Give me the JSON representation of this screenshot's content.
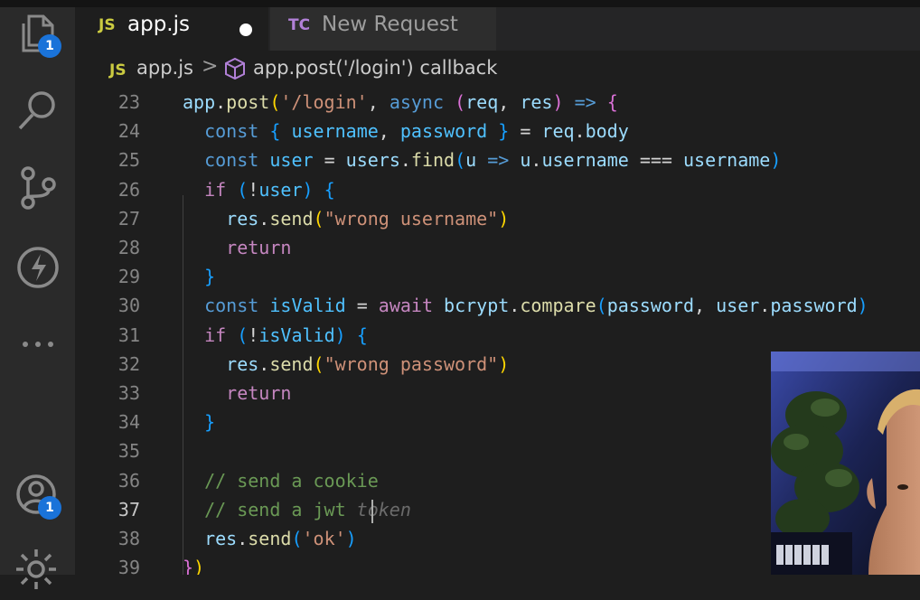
{
  "activity_bar": {
    "explorer_badge": "1",
    "accounts_badge": "1"
  },
  "tabs": [
    {
      "icon_text": "JS",
      "label": "app.js",
      "icon_color": "#cbcb41",
      "label_color": "#ffffff"
    },
    {
      "icon_text": "TC",
      "label": "New Request",
      "icon_color": "#b180d7",
      "label_color": "#9d9d9d"
    }
  ],
  "breadcrumb": {
    "file_icon": "JS",
    "file": "app.js",
    "separator": ">",
    "symbol": "app.post('/login') callback"
  },
  "editor": {
    "line_numbers": [
      "23",
      "24",
      "25",
      "26",
      "27",
      "28",
      "29",
      "30",
      "31",
      "32",
      "33",
      "34",
      "35",
      "36",
      "37",
      "38",
      "39"
    ],
    "current_line": "37",
    "lines": [
      [
        {
          "t": "app",
          "c": "var"
        },
        {
          "t": ".",
          "c": ""
        },
        {
          "t": "post",
          "c": "fn"
        },
        {
          "t": "(",
          "c": "b1"
        },
        {
          "t": "'/login'",
          "c": "str"
        },
        {
          "t": ", ",
          "c": ""
        },
        {
          "t": "async",
          "c": "kw"
        },
        {
          "t": " ",
          "c": ""
        },
        {
          "t": "(",
          "c": "b2"
        },
        {
          "t": "req",
          "c": "var"
        },
        {
          "t": ", ",
          "c": ""
        },
        {
          "t": "res",
          "c": "var"
        },
        {
          "t": ")",
          "c": "b2"
        },
        {
          "t": " ",
          "c": ""
        },
        {
          "t": "=>",
          "c": "kw"
        },
        {
          "t": " ",
          "c": ""
        },
        {
          "t": "{",
          "c": "b2"
        }
      ],
      [
        {
          "t": "  ",
          "c": ""
        },
        {
          "t": "const",
          "c": "kw"
        },
        {
          "t": " ",
          "c": ""
        },
        {
          "t": "{",
          "c": "b3"
        },
        {
          "t": " ",
          "c": ""
        },
        {
          "t": "username",
          "c": "cst"
        },
        {
          "t": ", ",
          "c": ""
        },
        {
          "t": "password",
          "c": "cst"
        },
        {
          "t": " ",
          "c": ""
        },
        {
          "t": "}",
          "c": "b3"
        },
        {
          "t": " = ",
          "c": ""
        },
        {
          "t": "req",
          "c": "var"
        },
        {
          "t": ".",
          "c": ""
        },
        {
          "t": "body",
          "c": "var"
        }
      ],
      [
        {
          "t": "  ",
          "c": ""
        },
        {
          "t": "const",
          "c": "kw"
        },
        {
          "t": " ",
          "c": ""
        },
        {
          "t": "user",
          "c": "cst"
        },
        {
          "t": " = ",
          "c": ""
        },
        {
          "t": "users",
          "c": "var"
        },
        {
          "t": ".",
          "c": ""
        },
        {
          "t": "find",
          "c": "fn"
        },
        {
          "t": "(",
          "c": "b3"
        },
        {
          "t": "u",
          "c": "var"
        },
        {
          "t": " ",
          "c": ""
        },
        {
          "t": "=>",
          "c": "kw"
        },
        {
          "t": " ",
          "c": ""
        },
        {
          "t": "u",
          "c": "var"
        },
        {
          "t": ".",
          "c": ""
        },
        {
          "t": "username",
          "c": "var"
        },
        {
          "t": " === ",
          "c": ""
        },
        {
          "t": "username",
          "c": "var"
        },
        {
          "t": ")",
          "c": "b3"
        }
      ],
      [
        {
          "t": "  ",
          "c": ""
        },
        {
          "t": "if",
          "c": "kw2"
        },
        {
          "t": " ",
          "c": ""
        },
        {
          "t": "(",
          "c": "b3"
        },
        {
          "t": "!",
          "c": ""
        },
        {
          "t": "user",
          "c": "cst"
        },
        {
          "t": ")",
          "c": "b3"
        },
        {
          "t": " ",
          "c": ""
        },
        {
          "t": "{",
          "c": "b3"
        }
      ],
      [
        {
          "t": "    ",
          "c": ""
        },
        {
          "t": "res",
          "c": "var"
        },
        {
          "t": ".",
          "c": ""
        },
        {
          "t": "send",
          "c": "fn"
        },
        {
          "t": "(",
          "c": "b1"
        },
        {
          "t": "\"wrong username\"",
          "c": "str"
        },
        {
          "t": ")",
          "c": "b1"
        }
      ],
      [
        {
          "t": "    ",
          "c": ""
        },
        {
          "t": "return",
          "c": "kw2"
        }
      ],
      [
        {
          "t": "  ",
          "c": ""
        },
        {
          "t": "}",
          "c": "b3"
        }
      ],
      [
        {
          "t": "  ",
          "c": ""
        },
        {
          "t": "const",
          "c": "kw"
        },
        {
          "t": " ",
          "c": ""
        },
        {
          "t": "isValid",
          "c": "cst"
        },
        {
          "t": " = ",
          "c": ""
        },
        {
          "t": "await",
          "c": "kw2"
        },
        {
          "t": " ",
          "c": ""
        },
        {
          "t": "bcrypt",
          "c": "var"
        },
        {
          "t": ".",
          "c": ""
        },
        {
          "t": "compare",
          "c": "fn"
        },
        {
          "t": "(",
          "c": "b3"
        },
        {
          "t": "password",
          "c": "var"
        },
        {
          "t": ", ",
          "c": ""
        },
        {
          "t": "user",
          "c": "var"
        },
        {
          "t": ".",
          "c": ""
        },
        {
          "t": "password",
          "c": "var"
        },
        {
          "t": ")",
          "c": "b3"
        }
      ],
      [
        {
          "t": "  ",
          "c": ""
        },
        {
          "t": "if",
          "c": "kw2"
        },
        {
          "t": " ",
          "c": ""
        },
        {
          "t": "(",
          "c": "b3"
        },
        {
          "t": "!",
          "c": ""
        },
        {
          "t": "isValid",
          "c": "cst"
        },
        {
          "t": ")",
          "c": "b3"
        },
        {
          "t": " ",
          "c": ""
        },
        {
          "t": "{",
          "c": "b3"
        }
      ],
      [
        {
          "t": "    ",
          "c": ""
        },
        {
          "t": "res",
          "c": "var"
        },
        {
          "t": ".",
          "c": ""
        },
        {
          "t": "send",
          "c": "fn"
        },
        {
          "t": "(",
          "c": "b1"
        },
        {
          "t": "\"wrong password\"",
          "c": "str"
        },
        {
          "t": ")",
          "c": "b1"
        }
      ],
      [
        {
          "t": "    ",
          "c": ""
        },
        {
          "t": "return",
          "c": "kw2"
        }
      ],
      [
        {
          "t": "  ",
          "c": ""
        },
        {
          "t": "}",
          "c": "b3"
        }
      ],
      [],
      [
        {
          "t": "  ",
          "c": ""
        },
        {
          "t": "// send a cookie",
          "c": "cm"
        }
      ],
      [
        {
          "t": "  ",
          "c": ""
        },
        {
          "t": "// send a jwt ",
          "c": "cm"
        },
        {
          "t": "token",
          "c": "ghost"
        }
      ],
      [
        {
          "t": "  ",
          "c": ""
        },
        {
          "t": "res",
          "c": "var"
        },
        {
          "t": ".",
          "c": ""
        },
        {
          "t": "send",
          "c": "fn"
        },
        {
          "t": "(",
          "c": "b3"
        },
        {
          "t": "'ok'",
          "c": "str"
        },
        {
          "t": ")",
          "c": "b3"
        }
      ],
      [
        {
          "t": "}",
          "c": "b2"
        },
        {
          "t": ")",
          "c": "b1"
        }
      ]
    ]
  },
  "colors": {
    "editor_bg": "#1e1e1e",
    "activity_bg": "#2a2a2a",
    "badge": "#1a73d9",
    "keyword": "#569cd6",
    "control": "#c586c0",
    "function": "#dcdcaa",
    "string": "#ce9178",
    "variable": "#9cdcfe",
    "constant": "#4fc1ff",
    "comment": "#6a9955"
  },
  "icons": [
    "files-icon",
    "search-icon",
    "source-control-icon",
    "thunder-client-icon",
    "more-icon",
    "accounts-icon",
    "settings-gear-icon",
    "cube-icon"
  ]
}
